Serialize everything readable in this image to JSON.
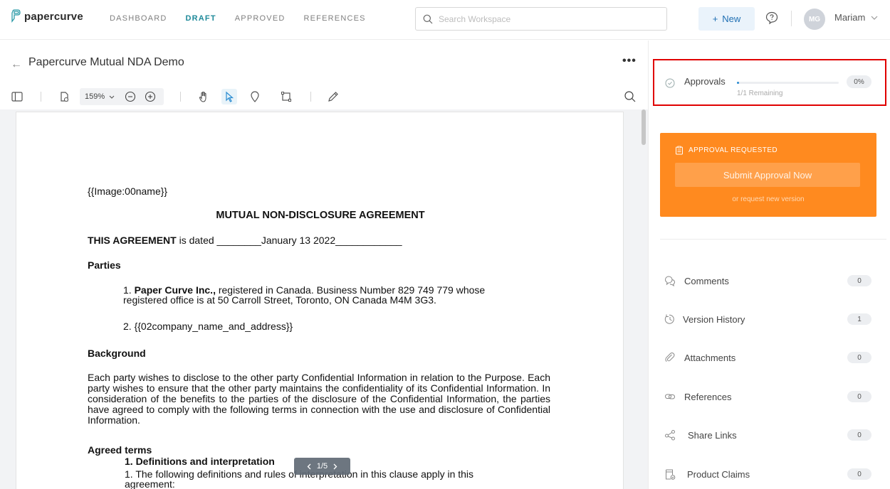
{
  "app": {
    "logo_text": "papercurve"
  },
  "nav": [
    {
      "label": "DASHBOARD",
      "active": false
    },
    {
      "label": "DRAFT",
      "active": true
    },
    {
      "label": "APPROVED",
      "active": false
    },
    {
      "label": "REFERENCES",
      "active": false
    }
  ],
  "search": {
    "placeholder": "Search Workspace"
  },
  "header": {
    "new_label": "New",
    "new_plus": "+",
    "user_initials": "MG",
    "user_name": "Mariam"
  },
  "doc": {
    "back_arrow": "←",
    "title": "Papercurve Mutual NDA Demo",
    "more": "•••",
    "zoom": "159%",
    "pager": {
      "current": "1/5"
    }
  },
  "page": {
    "image_tag": "{{Image:00name}}",
    "heading": "MUTUAL NON-DISCLOSURE AGREEMENT",
    "dated_bold": "THIS AGREEMENT",
    "dated_rest": " is dated ________January 13 2022____________",
    "parties_heading": "Parties",
    "party1_num": "1. ",
    "party1_bold": "Paper Curve Inc.,",
    "party1_rest": " registered in Canada. Business Number 829 749 779 whose",
    "party1_line2": "registered office is at 50 Carroll Street, Toronto, ON Canada M4M 3G3.",
    "party2": "2. {{02company_name_and_address}}",
    "background_heading": "Background",
    "background_text": "Each party wishes to disclose to the other party Confidential Information in relation to the Purpose. Each party wishes to ensure that the other party maintains the confidentiality of its Confidential Information. In consideration of the benefits to the parties of the disclosure of the Confidential Information, the parties have agreed to comply with the following terms in connection with the use and disclosure of Confidential Information.",
    "agreed_heading": "Agreed terms",
    "definitions_heading": "1. Definitions and interpretation",
    "definitions_line1": "1. The following definitions and rules of interpretation in this clause apply in this",
    "definitions_line2": "agreement:"
  },
  "approvals": {
    "label": "Approvals",
    "percent": "0%",
    "remaining": "1/1 Remaining",
    "progress_fraction": 0.02
  },
  "approval_card": {
    "status": "APPROVAL REQUESTED",
    "submit_label": "Submit Approval Now",
    "request_new": "or request new version"
  },
  "sidebar_items": [
    {
      "label": "Comments",
      "count": "0",
      "icon": "comments-icon"
    },
    {
      "label": "Version History",
      "count": "1",
      "icon": "history-icon"
    },
    {
      "label": "Attachments",
      "count": "0",
      "icon": "paperclip-icon"
    },
    {
      "label": "References",
      "count": "0",
      "icon": "link-icon"
    },
    {
      "label": "Share Links",
      "count": "0",
      "icon": "share-icon"
    },
    {
      "label": "Product Claims",
      "count": "0",
      "icon": "claims-icon"
    }
  ],
  "colors": {
    "accent": "#1f8a9a",
    "orange": "#ff8a1f",
    "highlight": "#e00000",
    "new_button": "#1f6fb3"
  }
}
